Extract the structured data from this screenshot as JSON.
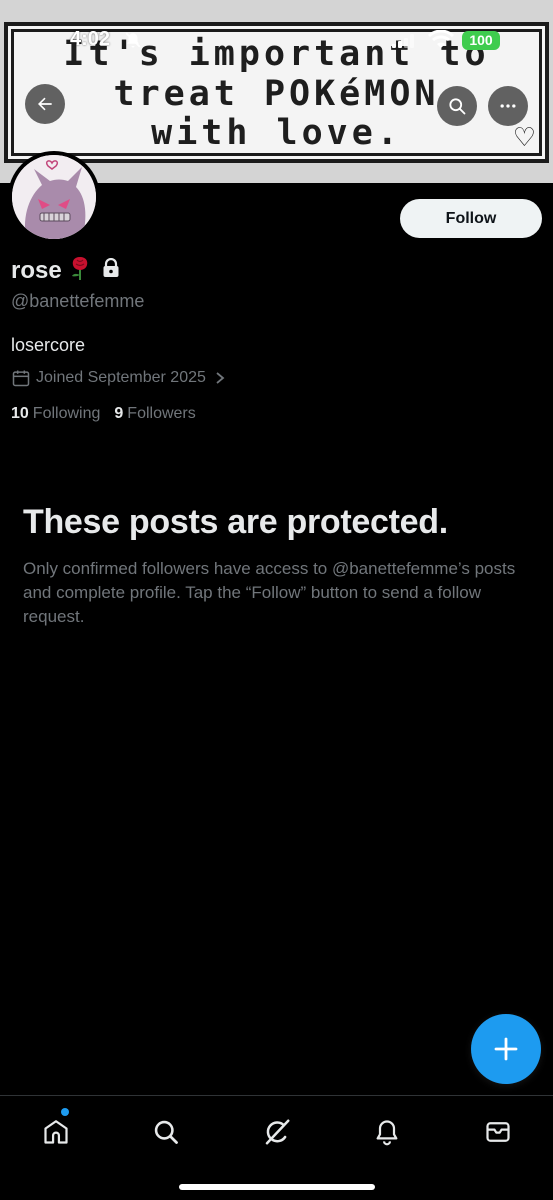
{
  "status_bar": {
    "time": "4:02",
    "battery": "100"
  },
  "banner": {
    "lines": [
      "It's important to",
      "treat POKéMON",
      "with love."
    ]
  },
  "profile": {
    "display_name": "rose",
    "handle": "@banettefemme",
    "bio": "losercore",
    "joined": "Joined September 2025",
    "following_count": "10",
    "following_label": "Following",
    "followers_count": "9",
    "followers_label": "Followers",
    "follow_label": "Follow"
  },
  "protected": {
    "title": "These posts are protected.",
    "body": "Only confirmed followers have access to @banettefemme’s posts and complete profile. Tap the “Follow” button to send a follow request."
  },
  "nav": {
    "items": [
      "home-icon",
      "search-icon",
      "grok-icon",
      "notifications-icon",
      "messages-icon"
    ]
  },
  "colors": {
    "accent": "#1d9bf0",
    "muted_text": "#71767b",
    "primary_text": "#e7e9ea",
    "battery": "#3fcc4e"
  }
}
